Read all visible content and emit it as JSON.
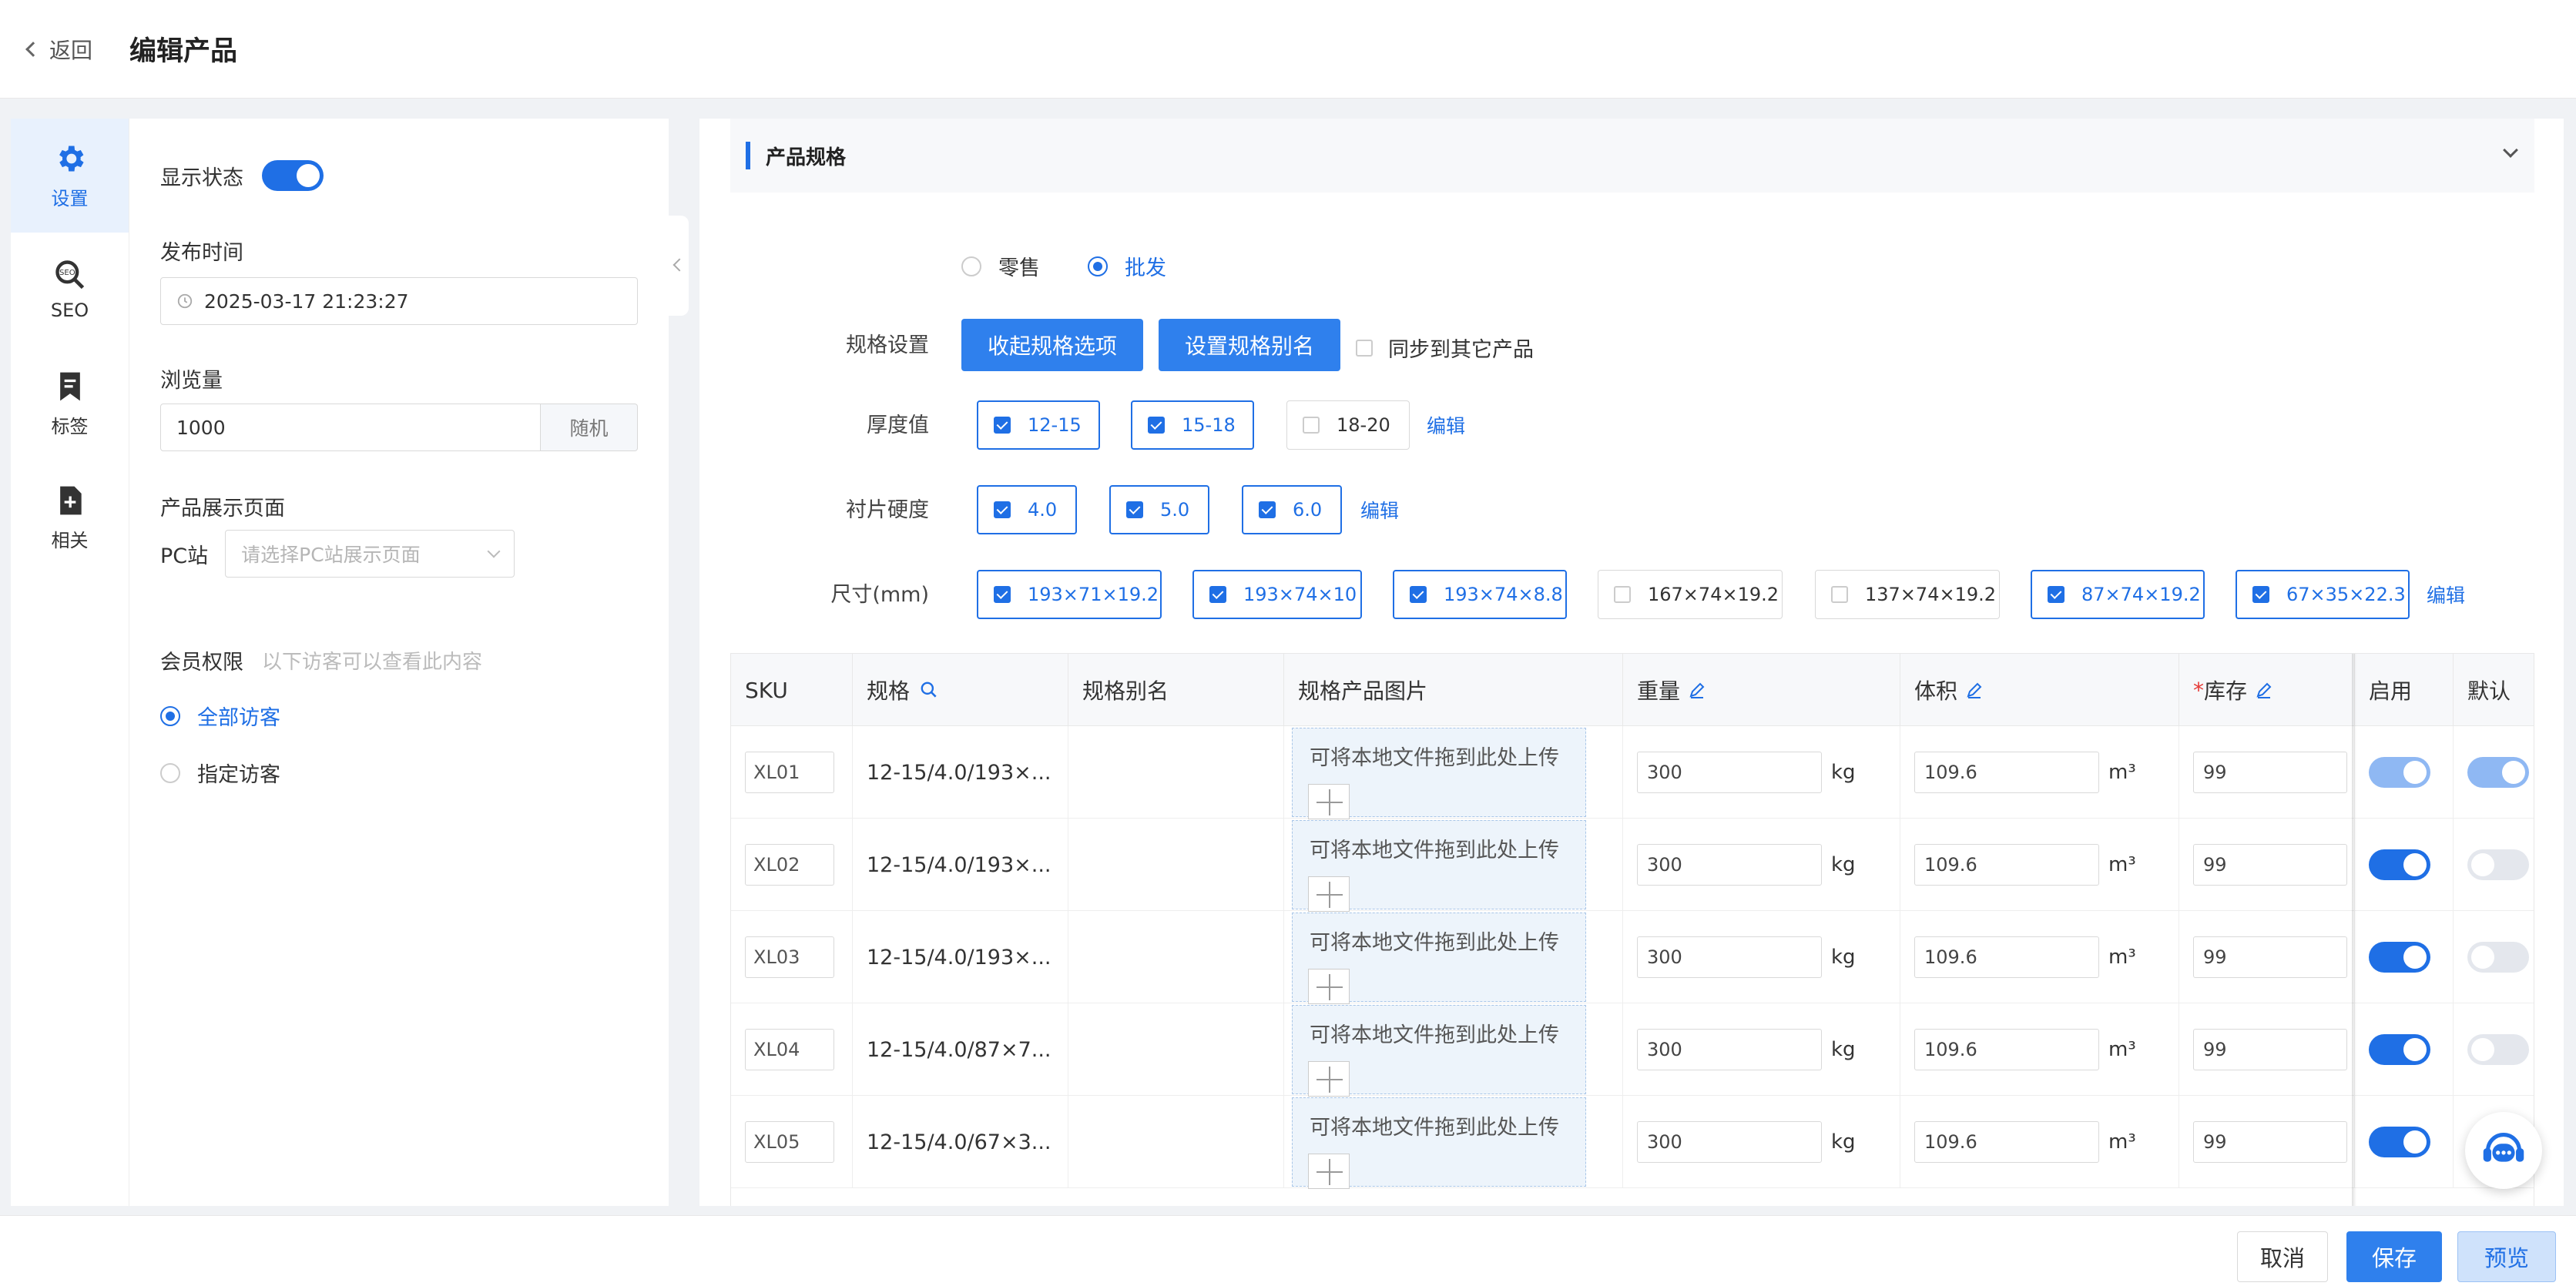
{
  "header": {
    "back_label": "返回",
    "title": "编辑产品"
  },
  "nav": {
    "items": [
      {
        "label": "设置",
        "icon": "gear-icon"
      },
      {
        "label": "SEO",
        "icon": "seo-icon"
      },
      {
        "label": "标签",
        "icon": "bookmark-icon"
      },
      {
        "label": "相关",
        "icon": "add-file-icon"
      }
    ]
  },
  "settings": {
    "display_status_label": "显示状态",
    "display_status_on": true,
    "publish_time_label": "发布时间",
    "publish_time_value": "2025-03-17 21:23:27",
    "views_label": "浏览量",
    "views_value": "1000",
    "views_random_btn": "随机",
    "display_page_label": "产品展示页面",
    "pc_site_label": "PC站",
    "pc_site_placeholder": "请选择PC站展示页面",
    "member_label": "会员权限",
    "member_hint": "以下访客可以查看此内容",
    "member_opt_all": "全部访客",
    "member_opt_specific": "指定访客"
  },
  "spec": {
    "section_title": "产品规格",
    "mode_retail": "零售",
    "mode_wholesale": "批发",
    "spec_setting_label": "规格设置",
    "btn_collapse": "收起规格选项",
    "btn_alias": "设置规格别名",
    "sync_label": "同步到其它产品",
    "edit_label": "编辑",
    "thickness_label": "厚度值",
    "thickness": [
      "12-15",
      "15-18",
      "18-20"
    ],
    "hardness_label": "衬片硬度",
    "hardness": [
      "4.0",
      "5.0",
      "6.0"
    ],
    "size_label": "尺寸(mm)",
    "sizes": [
      "193×71×19.2",
      "193×74×10",
      "193×74×8.8",
      "167×74×19.2",
      "137×74×19.2",
      "87×74×19.2",
      "67×35×22.3"
    ]
  },
  "table": {
    "headers": {
      "sku": "SKU",
      "spec": "规格",
      "alias": "规格别名",
      "image": "规格产品图片",
      "weight": "重量",
      "volume": "体积",
      "stock_req": "*",
      "stock": "库存",
      "enable": "启用",
      "default": "默认"
    },
    "upload_text": "可将本地文件拖到此处上传",
    "weight_unit": "kg",
    "volume_unit": "m³",
    "rows": [
      {
        "sku": "XL01",
        "spec": "12-15/4.0/193×...",
        "weight": "300",
        "volume": "109.6",
        "stock": "99"
      },
      {
        "sku": "XL02",
        "spec": "12-15/4.0/193×...",
        "weight": "300",
        "volume": "109.6",
        "stock": "99"
      },
      {
        "sku": "XL03",
        "spec": "12-15/4.0/193×...",
        "weight": "300",
        "volume": "109.6",
        "stock": "99"
      },
      {
        "sku": "XL04",
        "spec": "12-15/4.0/87×7...",
        "weight": "300",
        "volume": "109.6",
        "stock": "99"
      },
      {
        "sku": "XL05",
        "spec": "12-15/4.0/67×3...",
        "weight": "300",
        "volume": "109.6",
        "stock": "99"
      }
    ]
  },
  "footer": {
    "cancel": "取消",
    "save": "保存",
    "preview": "预览"
  },
  "colors": {
    "primary": "#2f80ed",
    "accent": "#1f6fe5"
  }
}
